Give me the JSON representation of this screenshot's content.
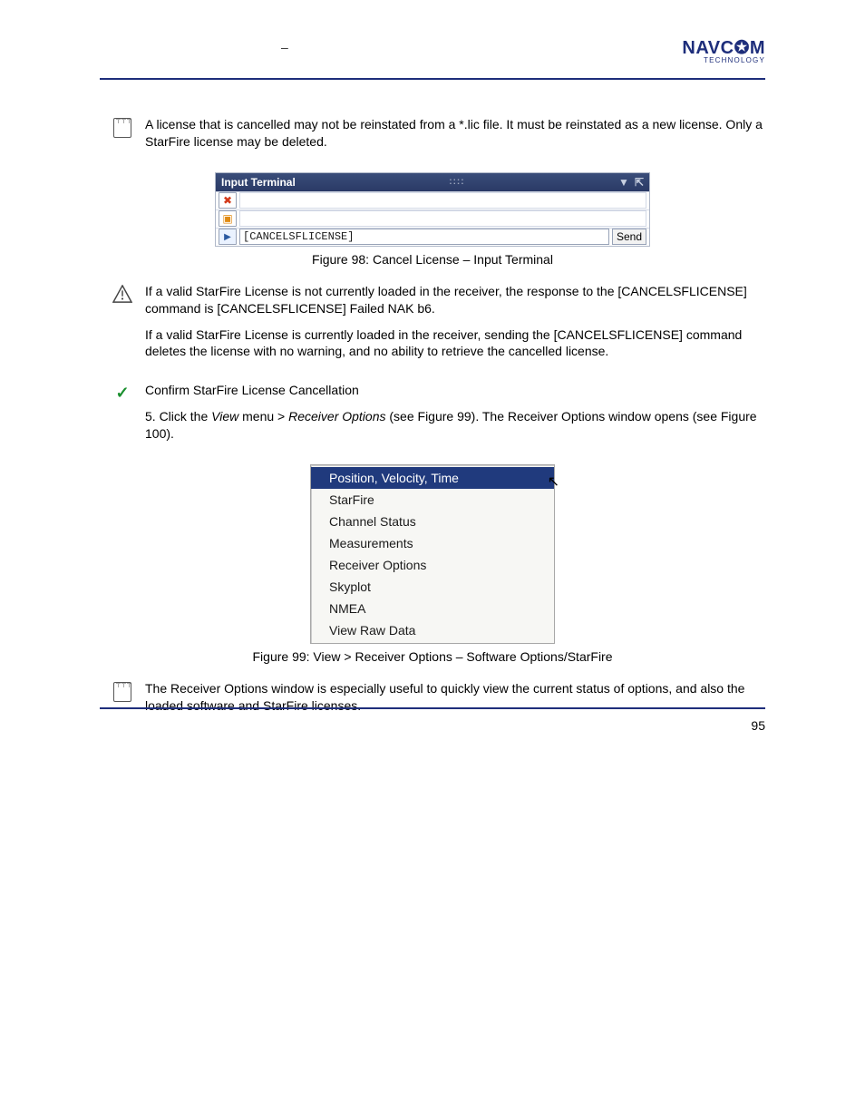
{
  "header": {
    "mid_dash": "–",
    "brand_line1": "NAVC✪M",
    "brand_line2": "TECHNOLOGY"
  },
  "note1": {
    "text": "A license that is cancelled may not be reinstated from a *.lic file. It must be reinstated as a new license. Only a StarFire license may be deleted."
  },
  "fig98": {
    "title": "Input Terminal",
    "row3_cmd": "[CANCELSFLICENSE]",
    "send": "Send",
    "caption_prefix": "Figure 98:  Cancel License ",
    "caption_dash": "–",
    "caption_suffix": " Input Terminal"
  },
  "warn": {
    "para1": "If a valid StarFire License is not currently loaded in the receiver, the response to the [CANCELSFLICENSE] command is [CANCELSFLICENSE] Failed  NAK b6.",
    "para2": "If a valid StarFire License is currently loaded in the receiver, sending the [CANCELSFLICENSE] command deletes the license with no warning, and no ability to retrieve the cancelled license."
  },
  "steps": {
    "confirm_heading": "Confirm StarFire License Cancellation",
    "s5": "5.  Click the ",
    "s5_em": "View",
    "s5_after": " menu > ",
    "s5_em2": "Receiver Options",
    "s5_after2": " (see Figure 99).",
    "s5_cont": " The Receiver Options window opens (see Figure 100)."
  },
  "fig99": {
    "items": [
      "Position, Velocity, Time",
      "StarFire",
      "Channel Status",
      "Measurements",
      "Receiver Options",
      "Skyplot",
      "NMEA",
      "View Raw Data"
    ],
    "caption_prefix": "Figure 99:  View > Receiver Options ",
    "caption_dash": "–",
    "caption_suffix": " Software Options/StarFire"
  },
  "note2": {
    "text": "The Receiver Options window is especially useful to quickly view the current status of options, and also the loaded software and StarFire licenses."
  },
  "footer": {
    "page": "95"
  }
}
